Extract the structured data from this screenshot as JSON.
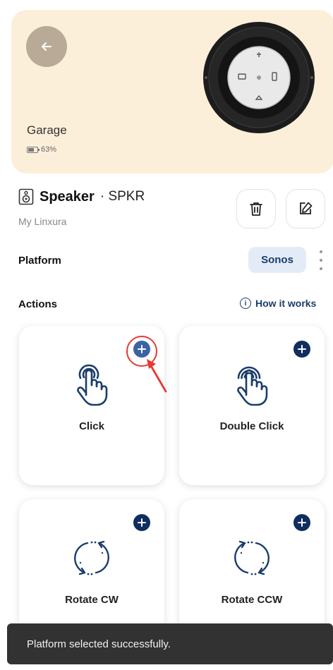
{
  "device": {
    "location": "Garage",
    "battery": "63%",
    "battery_level": 0.63,
    "name": "Speaker",
    "code_prefix": "· ",
    "code": "SPKR",
    "subtitle": "My Linxura"
  },
  "platform": {
    "label": "Platform",
    "selected": "Sonos"
  },
  "actions": {
    "label": "Actions",
    "how_it_works": "How it works",
    "info_glyph": "i",
    "items": [
      {
        "label": "Click",
        "icon": "tap-hand-icon"
      },
      {
        "label": "Double Click",
        "icon": "double-tap-hand-icon"
      },
      {
        "label": "Rotate CW",
        "icon": "rotate-cw-icon"
      },
      {
        "label": "Rotate CCW",
        "icon": "rotate-ccw-icon"
      }
    ]
  },
  "toast": {
    "message": "Platform selected successfully."
  },
  "colors": {
    "hero_bg": "#fcefd9",
    "accent": "#102d5f",
    "chip_bg": "#e3ecf6",
    "highlight": "#e53935",
    "toast_bg": "#323232"
  }
}
